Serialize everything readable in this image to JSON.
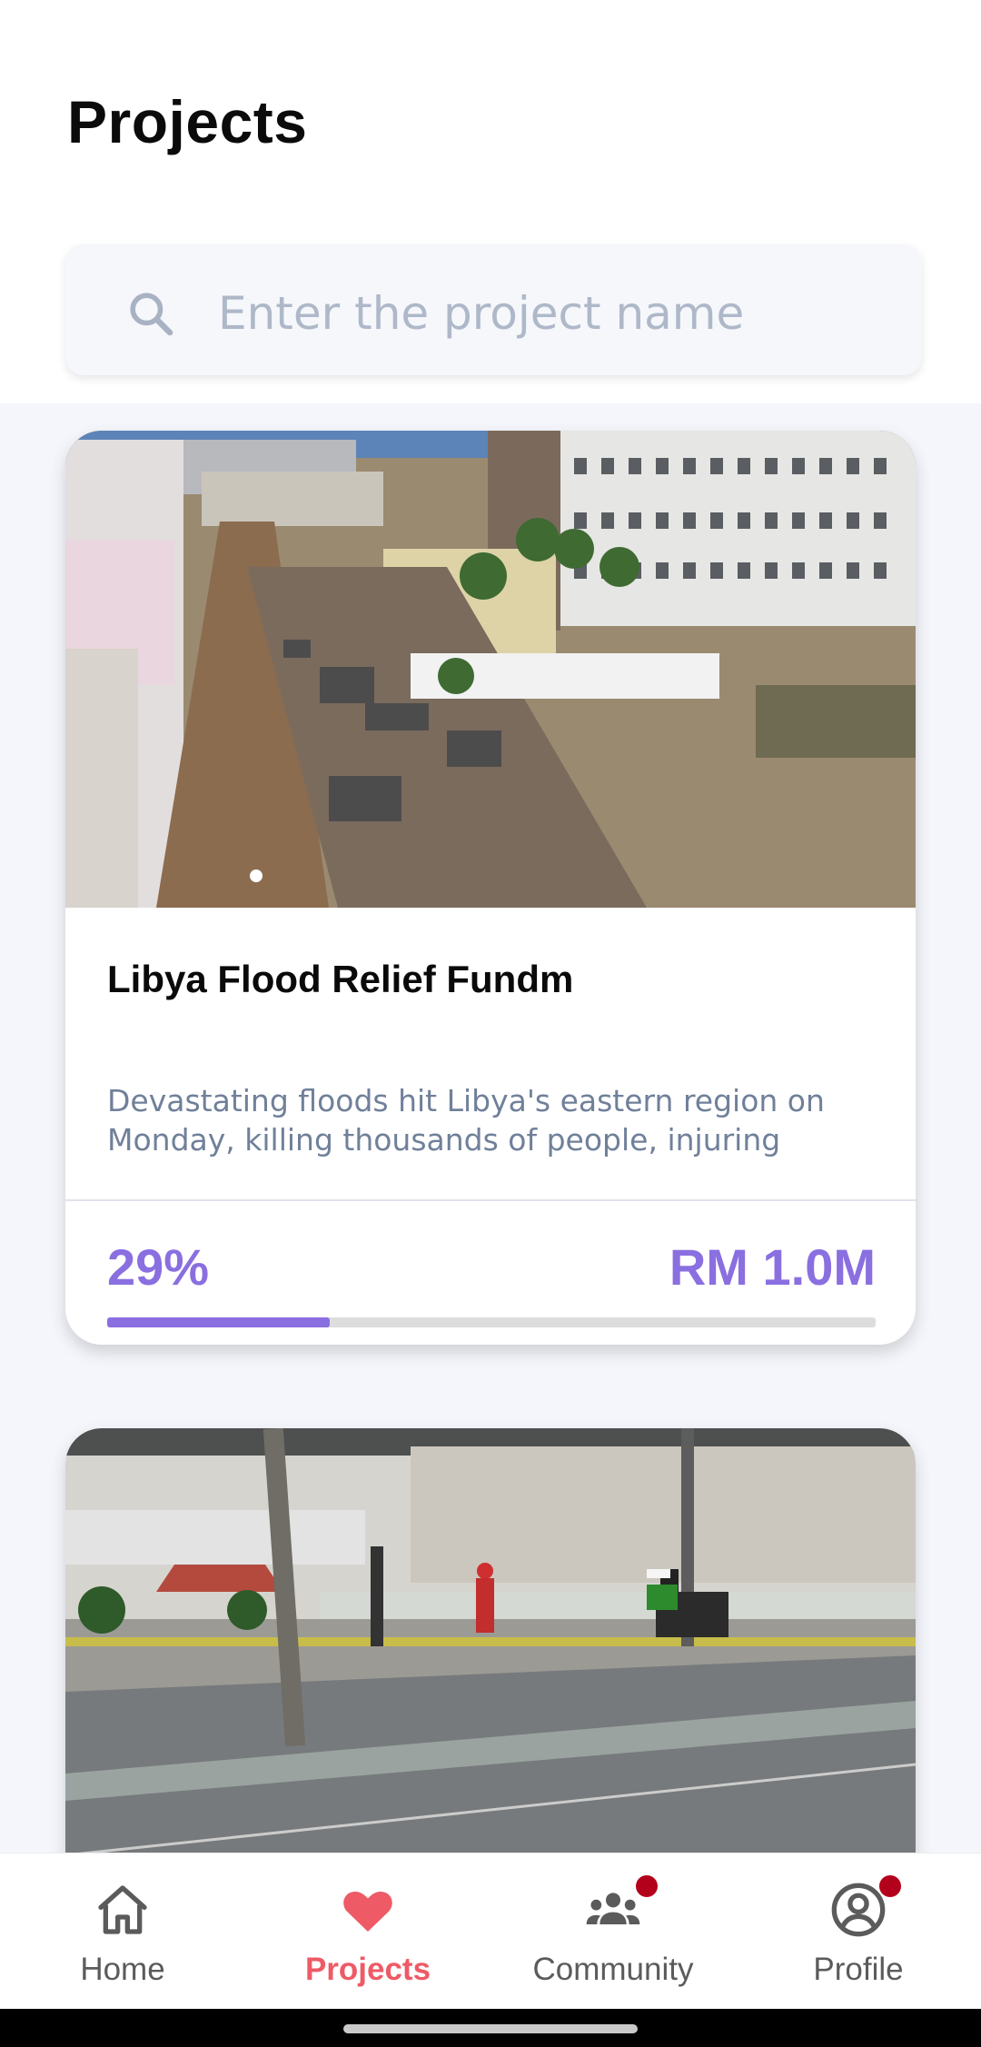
{
  "header": {
    "title": "Projects"
  },
  "search": {
    "placeholder": "Enter the project name",
    "value": ""
  },
  "projects": [
    {
      "title": "Libya Flood Relief Fundm",
      "description": "Devastating floods hit Libya's eastern region on Monday, killing thousands of people, injuring",
      "progress_label": "29%",
      "progress_fraction": 0.29,
      "amount": "RM 1.0M"
    },
    {
      "title": "",
      "description": ""
    }
  ],
  "nav": {
    "items": [
      {
        "label": "Home",
        "icon": "home-icon",
        "active": false
      },
      {
        "label": "Projects",
        "icon": "heart-icon",
        "active": true
      },
      {
        "label": "Community",
        "icon": "community-icon",
        "active": false,
        "badge": true
      },
      {
        "label": "Profile",
        "icon": "profile-icon",
        "active": false,
        "badge": true
      }
    ]
  },
  "colors": {
    "accent": "#8a6fe0",
    "active_nav": "#ee5a66",
    "badge": "#b3001b"
  }
}
